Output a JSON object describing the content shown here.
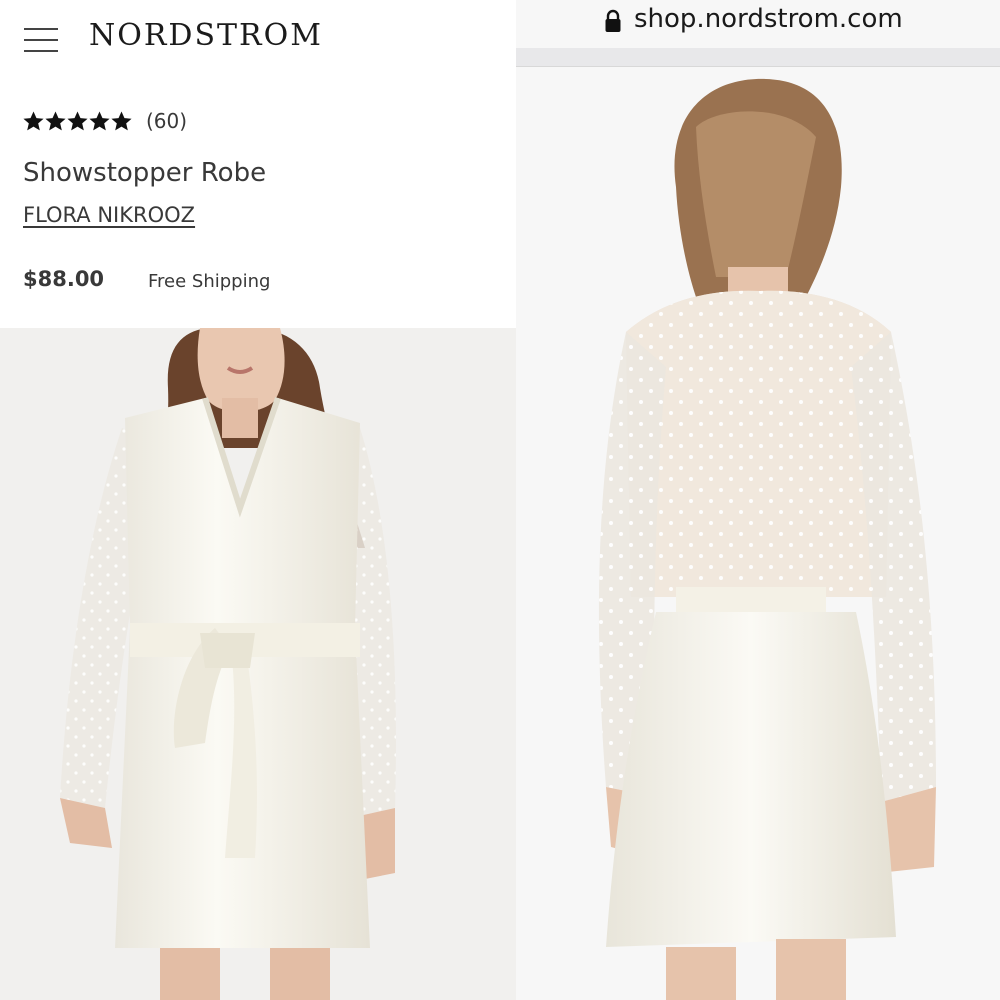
{
  "header": {
    "brand": "NORDSTROM",
    "menu_icon": "hamburger-menu-icon"
  },
  "product": {
    "rating_stars": 5,
    "rating_count": "(60)",
    "title": "Showstopper Robe",
    "designer": "FLORA NIKROOZ",
    "price": "$88.00",
    "shipping": "Free Shipping"
  },
  "browser": {
    "url": "shop.nordstrom.com",
    "lock_icon": "lock-icon"
  },
  "images": {
    "front": "model-front-photo",
    "back": "model-back-photo"
  },
  "colors": {
    "text": "#393939",
    "brand": "#1b1b1b",
    "robe": "#f5f3ea"
  }
}
